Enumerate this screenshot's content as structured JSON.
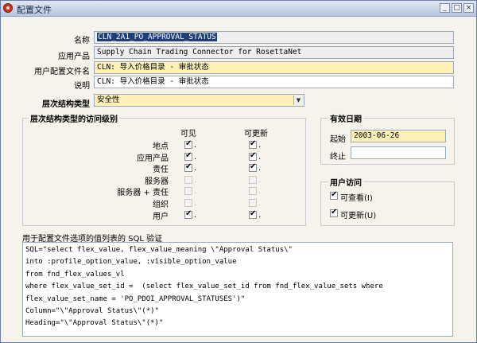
{
  "window": {
    "title": "配置文件",
    "min_label": "_",
    "max_label": "□",
    "close_label": "×"
  },
  "form": {
    "name_label": "名称",
    "name_value": "CLN_2A1_PO_APPROVAL_STATUS",
    "app_label": "应用产品",
    "app_value": "Supply Chain Trading Connector for RosettaNet",
    "user_profile_label": "用户配置文件名",
    "user_profile_value": "CLN: 导入价格目录 - 审批状态",
    "desc_label": "说明",
    "desc_value": "CLN: 导入价格目录 - 审批状态",
    "hier_type_label": "层次结构类型",
    "hier_type_value": "安全性"
  },
  "access": {
    "group_title": "层次结构类型的访问级别",
    "col_visible": "可见",
    "col_updatable": "可更新",
    "rows": [
      {
        "label": "地点",
        "visible": true,
        "updatable": true,
        "enabled": true
      },
      {
        "label": "应用产品",
        "visible": true,
        "updatable": true,
        "enabled": true
      },
      {
        "label": "责任",
        "visible": true,
        "updatable": true,
        "enabled": true
      },
      {
        "label": "服务器",
        "visible": false,
        "updatable": false,
        "enabled": false
      },
      {
        "label": "服务器 + 责任",
        "visible": false,
        "updatable": false,
        "enabled": false
      },
      {
        "label": "组织",
        "visible": false,
        "updatable": false,
        "enabled": false
      },
      {
        "label": "用户",
        "visible": true,
        "updatable": true,
        "enabled": true
      }
    ]
  },
  "effective": {
    "group_title": "有效日期",
    "start_label": "起始",
    "start_value": "2003-06-26",
    "end_label": "终止",
    "end_value": ""
  },
  "user_access": {
    "group_title": "用户访问",
    "view_label": "可查看(I)",
    "view_checked": true,
    "update_label": "可更新(U)",
    "update_checked": true
  },
  "sql": {
    "label": "用于配置文件选项的值列表的 SQL 验证",
    "lines": [
      "SQL=\"select flex_value, flex_value_meaning \\\"Approval Status\\\"",
      "into :profile_option_value, :visible_option_value",
      "from fnd_flex_values_vl",
      "where flex_value_set_id =  (select flex_value_set_id from fnd_flex_value_sets where",
      "flex_value_set_name = 'PO_PDOI_APPROVAL_STATUSES')\"",
      "Column=\"\\\"Approval Status\\\"(*)\"",
      "Heading=\"\\\"Approval Status\\\"(*)\""
    ]
  }
}
